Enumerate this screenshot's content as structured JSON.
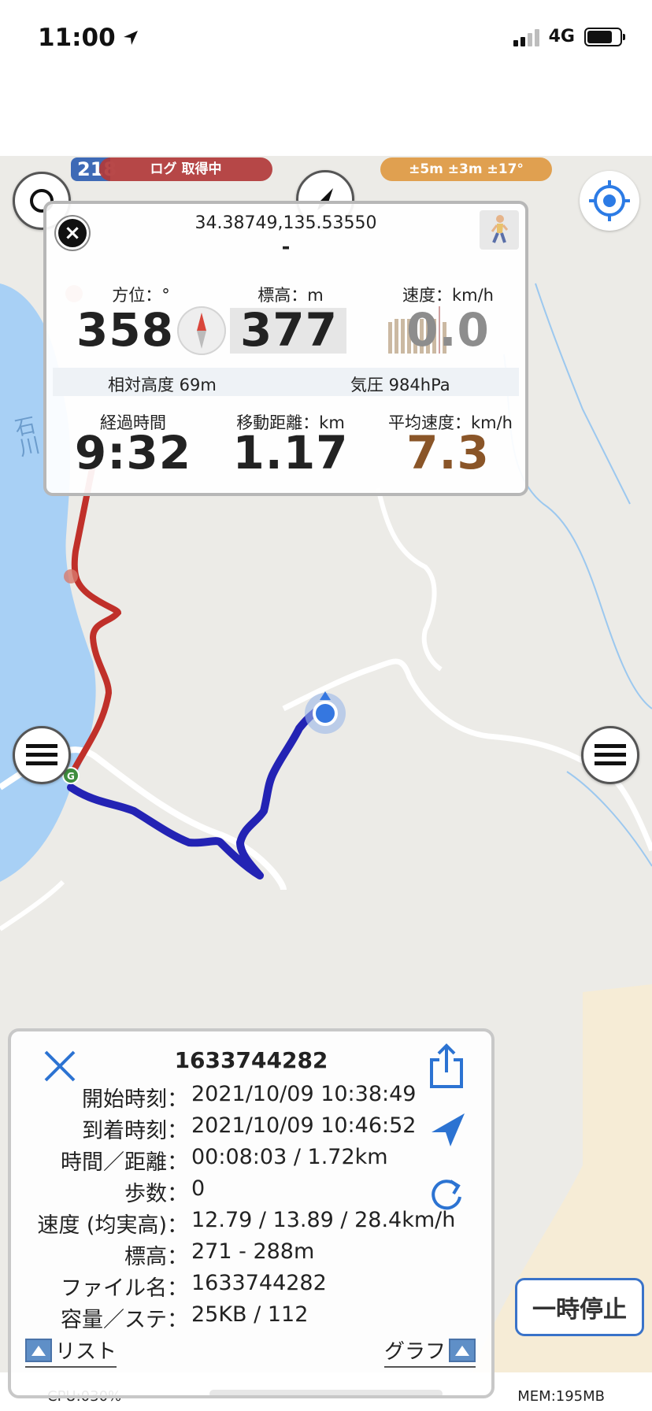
{
  "status_bar": {
    "time": "11:00",
    "network": "4G"
  },
  "map": {
    "route_number": "218",
    "log_status": "ログ 取得中",
    "accuracy": "±5m ±3m ±17°",
    "river_label": "石川",
    "track_colors": {
      "recorded": "#c0302a",
      "current": "#2222bb"
    }
  },
  "info_card": {
    "coordinates": "34.38749,135.53550",
    "address": "-",
    "heading_label": "方位：°",
    "heading_value": "358",
    "altitude_label": "標高：m",
    "altitude_value": "377",
    "speed_label": "速度：km/h",
    "speed_value": "0.0",
    "relative_altitude": "相対高度 69m",
    "pressure": "気圧 984hPa",
    "elapsed_label": "経過時間",
    "elapsed_value": "9:32",
    "distance_label": "移動距離：km",
    "distance_value": "1.17",
    "avg_speed_label": "平均速度：km/h",
    "avg_speed_value": "7.3"
  },
  "track_panel": {
    "title": "1633744282",
    "rows": [
      {
        "key": "開始時刻：",
        "value": "2021/10/09 10:38:49"
      },
      {
        "key": "到着時刻：",
        "value": "2021/10/09 10:46:52"
      },
      {
        "key": "時間／距離：",
        "value": "00:08:03 / 1.72km"
      },
      {
        "key": "歩数：",
        "value": "0"
      },
      {
        "key": "速度 (均実高)：",
        "value": "12.79 / 13.89 / 28.4km/h"
      },
      {
        "key": "標高：",
        "value": "271 - 288m"
      },
      {
        "key": "ファイル名：",
        "value": "1633744282"
      },
      {
        "key": "容量／ステ：",
        "value": "25KB / 112"
      }
    ],
    "list_label": "リスト",
    "graph_label": "グラフ"
  },
  "pause_label": "一時停止",
  "footer": {
    "cpu": "CPU:030%",
    "mem": "MEM:195MB"
  }
}
